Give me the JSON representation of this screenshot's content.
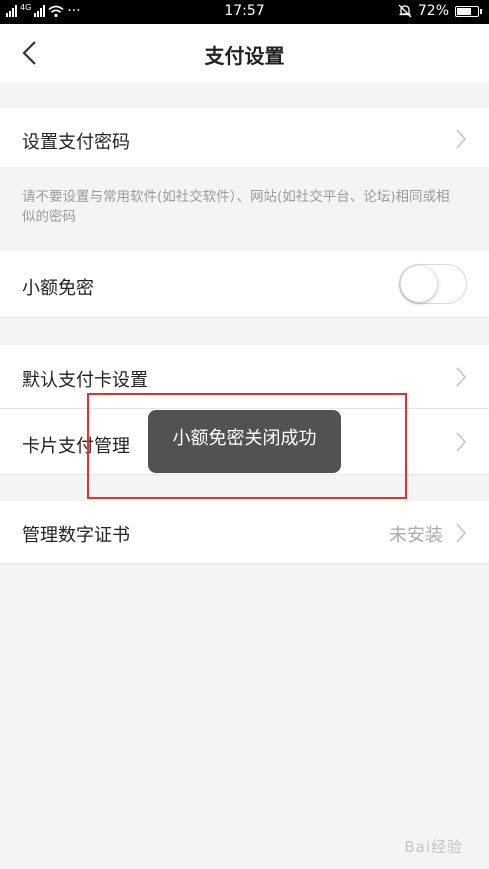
{
  "status_bar": {
    "left_network_1": "4G",
    "left_extra": "···",
    "time": "17:57",
    "battery": "72%",
    "battery_level": 0.72,
    "icons": [
      "signal-icon",
      "signal-4g-icon",
      "wifi-icon",
      "alarm-off-icon",
      "battery-icon"
    ]
  },
  "header": {
    "title": "支付设置",
    "back_icon": "back-chevron-icon"
  },
  "settings": {
    "set_password": {
      "label": "设置支付密码"
    },
    "hint": "请不要设置与常用软件(如社交软件）、网站(如社交平台、论坛)相同或相似的密码",
    "small_no_password": {
      "label": "小额免密",
      "toggle_on": false
    },
    "default_card": {
      "label": "默认支付卡设置"
    },
    "card_payment": {
      "label": "卡片支付管理"
    },
    "digital_cert": {
      "label": "管理数字证书",
      "value": "未安装"
    }
  },
  "toast": {
    "message": "小额免密关闭成功"
  },
  "colors": {
    "background": "#f3f4f6",
    "toast_bg": "#525252",
    "highlight_border": "#e0322f"
  },
  "watermark": "Bai经验"
}
